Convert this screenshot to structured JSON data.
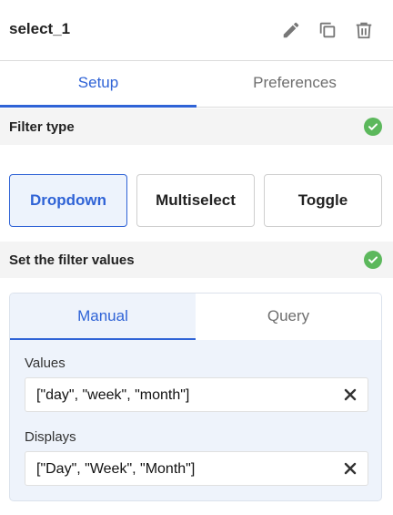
{
  "header": {
    "title": "select_1",
    "icons": [
      "pencil-icon",
      "copy-icon",
      "trash-icon"
    ]
  },
  "tabs": [
    {
      "label": "Setup",
      "active": true
    },
    {
      "label": "Preferences",
      "active": false
    }
  ],
  "filter_type": {
    "label": "Filter type",
    "options": [
      {
        "label": "Dropdown",
        "selected": true
      },
      {
        "label": "Multiselect",
        "selected": false
      },
      {
        "label": "Toggle",
        "selected": false
      }
    ]
  },
  "filter_values": {
    "label": "Set the filter values",
    "tabs": [
      {
        "label": "Manual",
        "active": true
      },
      {
        "label": "Query",
        "active": false
      }
    ],
    "values_label": "Values",
    "values": "[\"day\", \"week\", \"month\"]",
    "displays_label": "Displays",
    "displays": "[\"Day\", \"Week\", \"Month\"]"
  },
  "colors": {
    "accent": "#2f63d6",
    "success": "#5cb85c",
    "section_bg": "#f4f4f4",
    "card_bg": "#eef3fb"
  }
}
